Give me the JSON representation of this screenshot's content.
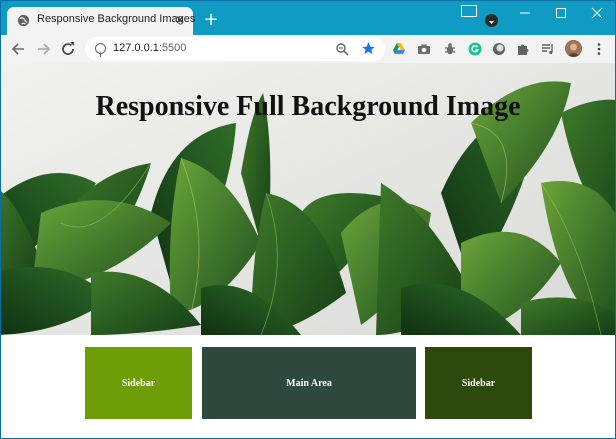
{
  "browser": {
    "tab_title": "Responsive Background Images",
    "new_tab_symbol": "+",
    "url_host": "127.0.0.1",
    "url_port": ":5500",
    "colors": {
      "titlebar": "#0f9bc4",
      "toolbar": "#f3f3f3",
      "star": "#1a73e8"
    }
  },
  "toolbar": {
    "extensions": [
      "google-drive-icon",
      "camera-icon",
      "bug-icon",
      "grammarly-icon",
      "circle-extension-icon",
      "puzzle-icon",
      "media-controls-icon"
    ]
  },
  "page": {
    "heading": "Responsive Full Background Image",
    "boxes": [
      {
        "label": "Sidebar",
        "color": "#6e9e07"
      },
      {
        "label": "Main Area",
        "color": "#2f4a3c"
      },
      {
        "label": "Sidebar",
        "color": "#2b4a0b"
      }
    ]
  }
}
